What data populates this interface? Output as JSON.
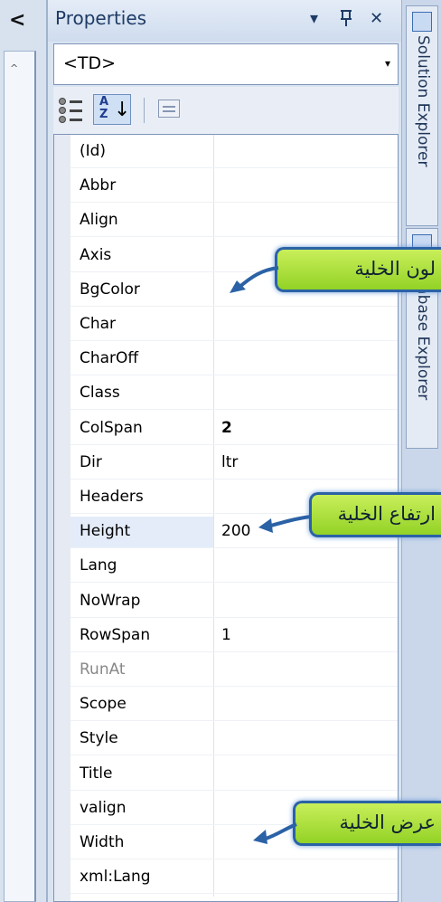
{
  "left_strip": {
    "chevron": "<",
    "caret": "^"
  },
  "properties": {
    "title": "Properties",
    "buttons": {
      "dropdown": "▾",
      "pin": "ᵽ",
      "close": "✕"
    },
    "object_select": {
      "value": "<TD>",
      "arrow": "▾"
    },
    "toolbar": {
      "categorized_icon": "categorized-icon",
      "alphabetical_icon": "alphabetical-sort-icon",
      "alpha_top": "A",
      "alpha_bottom": "Z",
      "alpha_arrow": "↓",
      "pages_icon": "property-pages-icon"
    },
    "rows": [
      {
        "name": "(Id)",
        "value": ""
      },
      {
        "name": "Abbr",
        "value": ""
      },
      {
        "name": "Align",
        "value": ""
      },
      {
        "name": "Axis",
        "value": ""
      },
      {
        "name": "BgColor",
        "value": ""
      },
      {
        "name": "Char",
        "value": ""
      },
      {
        "name": "CharOff",
        "value": ""
      },
      {
        "name": "Class",
        "value": ""
      },
      {
        "name": "ColSpan",
        "value": "2"
      },
      {
        "name": "Dir",
        "value": "ltr"
      },
      {
        "name": "Headers",
        "value": ""
      },
      {
        "name": "Height",
        "value": "200"
      },
      {
        "name": "Lang",
        "value": ""
      },
      {
        "name": "NoWrap",
        "value": ""
      },
      {
        "name": "RowSpan",
        "value": "1"
      },
      {
        "name": "RunAt",
        "value": ""
      },
      {
        "name": "Scope",
        "value": ""
      },
      {
        "name": "Style",
        "value": ""
      },
      {
        "name": "Title",
        "value": ""
      },
      {
        "name": "valign",
        "value": ""
      },
      {
        "name": "Width",
        "value": ""
      },
      {
        "name": "xml:Lang",
        "value": ""
      }
    ]
  },
  "right_tabs": [
    {
      "label": "Solution Explorer",
      "icon": "solution-explorer-icon"
    },
    {
      "label": "Database Explorer",
      "icon": "database-explorer-icon"
    }
  ],
  "annotations": {
    "bgcolor": "لون الخلية",
    "height": "ارتفاع الخلية",
    "width": "عرض الخلية"
  },
  "colors": {
    "callout_fill": "#a6dd32",
    "callout_border": "#2b62a6",
    "arrow": "#2b62a6",
    "selected_row": "#e4ecf9"
  }
}
